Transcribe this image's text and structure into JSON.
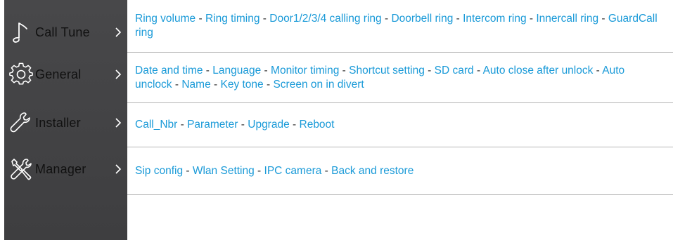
{
  "sidebar": {
    "items": [
      {
        "label": "Call Tune",
        "icon": "music-note-icon"
      },
      {
        "label": "General",
        "icon": "gear-icon"
      },
      {
        "label": "Installer",
        "icon": "wrench-icon"
      },
      {
        "label": "Manager",
        "icon": "tools-icon"
      }
    ],
    "chevron": ">"
  },
  "rows": [
    {
      "links": [
        "Ring volume",
        "Ring timing",
        "Door1/2/3/4 calling ring",
        "Doorbell ring",
        "Intercom ring",
        "Innercall ring",
        "GuardCall ring"
      ]
    },
    {
      "links": [
        "Date and time",
        "Language",
        "Monitor timing",
        "Shortcut setting",
        "SD card",
        "Auto close after unlock",
        "Auto unclock",
        "Name",
        "Key tone",
        "Screen on in divert"
      ]
    },
    {
      "links": [
        "Call_Nbr",
        "Parameter",
        "Upgrade",
        "Reboot"
      ]
    },
    {
      "links": [
        "Sip config",
        "Wlan Setting",
        "IPC camera",
        "Back and restore"
      ]
    }
  ],
  "separator": " - ",
  "colors": {
    "sidebar_bg": "#444446",
    "link": "#1a9ad8",
    "separator_text": "#333333",
    "row_border": "#b5b5b5",
    "label_text": "#111111",
    "icon_stroke": "#ffffff",
    "chevron": "#ffffff"
  }
}
